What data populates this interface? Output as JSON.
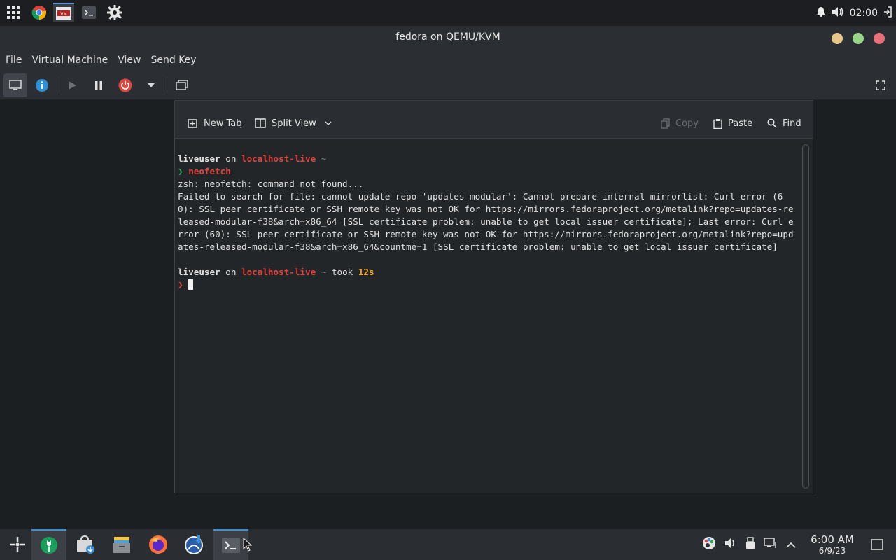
{
  "topbar": {
    "time": "02:00"
  },
  "window": {
    "title": "fedora on QEMU/KVM"
  },
  "menu": {
    "items": [
      "File",
      "Virtual Machine",
      "View",
      "Send Key"
    ]
  },
  "konsole": {
    "toolbar": {
      "new_tab": "New Tab",
      "split_view": "Split View",
      "copy": "Copy",
      "paste": "Paste",
      "find": "Find"
    },
    "terminal": {
      "prompt1_user": "liveuser",
      "prompt1_on": " on ",
      "prompt1_host": "localhost-live",
      "prompt1_dir": " ~",
      "prompt_char": "❯",
      "command": "neofetch",
      "output_line1": "zsh: neofetch: command not found...",
      "output_error": "Failed to search for file: cannot update repo 'updates-modular': Cannot prepare internal mirrorlist: Curl error (60): SSL peer certificate or SSH remote key was not OK for https://mirrors.fedoraproject.org/metalink?repo=updates-released-modular-f38&arch=x86_64 [SSL certificate problem: unable to get local issuer certificate]; Last error: Curl error (60): SSL peer certificate or SSH remote key was not OK for https://mirrors.fedoraproject.org/metalink?repo=updates-released-modular-f38&arch=x86_64&countme=1 [SSL certificate problem: unable to get local issuer certificate]",
      "prompt2_user": "liveuser",
      "prompt2_on": " on ",
      "prompt2_host": "localhost-live",
      "prompt2_dir": " ~",
      "prompt2_took": " took ",
      "prompt2_duration": "12s"
    }
  },
  "taskbar": {
    "time": "6:00 AM",
    "date": "6/9/23"
  },
  "colors": {
    "accent": "#3d8fd6",
    "prompt_red": "#e0443e",
    "prompt_green": "#2ea44f",
    "duration_yellow": "#f5a623",
    "power_red": "#e0443e",
    "info_blue": "#2e8fd6"
  }
}
